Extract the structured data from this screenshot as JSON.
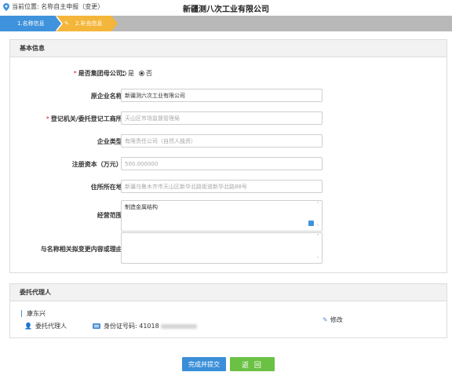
{
  "header": {
    "location_label": "当前位置: 名称自主申报（变更）",
    "company_title": "新疆测八次工业有限公司"
  },
  "steps": [
    {
      "label": "1.名称信息",
      "state": "done"
    },
    {
      "label": "2.补充信息",
      "state": "active"
    }
  ],
  "basic_info": {
    "title": "基本信息",
    "group_parent": {
      "label": "是否集团母公司:",
      "required": true,
      "options": [
        "是",
        "否"
      ],
      "selected": "否"
    },
    "original_name": {
      "label": "原企业名称:",
      "value": "新疆测六次工业有限公司"
    },
    "registration_authority": {
      "label": "登记机关/委托登记工商所:",
      "required": true,
      "placeholder": "天山区市场监督管理局"
    },
    "enterprise_type": {
      "label": "企业类型:",
      "placeholder": "有限责任公司（自然人独资）"
    },
    "registered_capital": {
      "label": "注册资本（万元）:",
      "placeholder": "500.000000"
    },
    "address": {
      "label": "住所所在地:",
      "placeholder": "新疆乌鲁木齐市天山区新华北路街道新华北路88号"
    },
    "business_scope": {
      "label": "经营范围:",
      "value": "制造金属结构"
    },
    "change_reason": {
      "label": "与名称相关拟变更内容或理由:",
      "value": ""
    }
  },
  "agent": {
    "title": "委托代理人",
    "name": "康东兴",
    "role": "委托代理人",
    "id_label": "身份证号码: 41018",
    "edit_label": "修改"
  },
  "buttons": {
    "submit": "完成并提交",
    "back": "返 回"
  },
  "colors": {
    "step_done": "#3f93dc",
    "step_active": "#f4b63a",
    "submit": "#3a8fd8",
    "back": "#6bc144",
    "required": "#e02020"
  }
}
